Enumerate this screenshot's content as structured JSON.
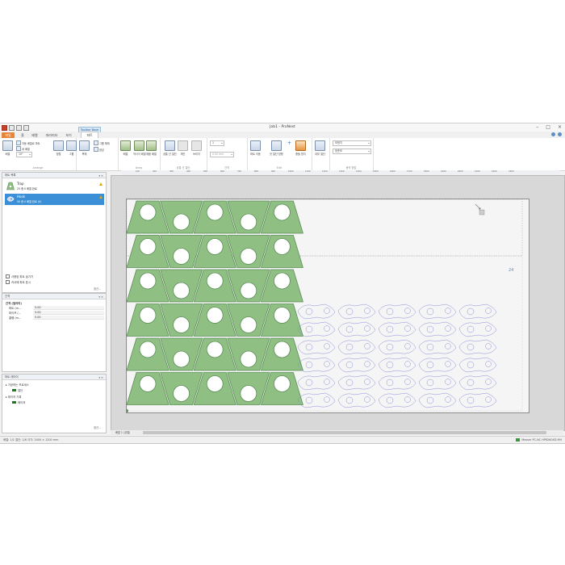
{
  "window": {
    "title": "Job1 - ProNest"
  },
  "tabs": {
    "file": "파일",
    "home": "홈",
    "nest": "배열",
    "cutting": "파라미터",
    "view": "보기",
    "context_group": "Toolbar Base",
    "context_tab": "파트"
  },
  "ribbon": {
    "nest_btn": "배열",
    "auto_nest": "자동 배열로 파트",
    "new_nest": "새 배열",
    "rotate_value": "10°",
    "align_btn": "정렬",
    "group_btn": "그룹",
    "copy_btn": "복제",
    "ungroup_btn": "그룹 해제",
    "lock_btn": "잠금",
    "arrange_label": "Arrange",
    "array_btn": "배열",
    "rect_array": "직사각 배열",
    "fill_array": "채움 배열",
    "array_label": "Array",
    "common_btn": "공통 선 절단",
    "chain_btn": "체인",
    "bridge_btn": "브리지",
    "common_label": "공통 선 절단",
    "spacing_value": "1",
    "spacing_mm": "0.00 mm",
    "spacing_label": "간격",
    "move_btn": "파트 이동",
    "cut_order": "컷 절단 방향",
    "plus": "+",
    "edit_label": "Edit",
    "collision": "충돌 방지",
    "inner": "내부 절단",
    "mirror_btn": "미러링",
    "view_sel1": "보정치",
    "view_sel2": "표준보",
    "view_label": "동작 방법"
  },
  "parts_panel": {
    "title": "파트 목록",
    "items": [
      {
        "name": "Trap",
        "sub": "25 중 0 배열 완료"
      },
      {
        "name": "Hook",
        "sub": "50 중 0 배열 완료 (0)"
      }
    ],
    "opt1": "사용된 파트 숨기기",
    "opt2": "커서에 파트 표시",
    "more": "옵션..."
  },
  "spacing_panel": {
    "title": "간격",
    "group": "간격 (밀리미)",
    "rows": [
      {
        "label": "파트 (m...",
        "value": "5.00"
      },
      {
        "label": "파이프 (...",
        "value": "5.00"
      },
      {
        "label": "클램 (m...",
        "value": "5.00"
      }
    ]
  },
  "layers_panel": {
    "title": "파트 레이어",
    "l1": "가공하는 프로세스",
    "l1a": "절단",
    "l2": "레이저 기록",
    "l2a": "레이저",
    "more": "옵션..."
  },
  "ruler": {
    "ticks": [
      "100",
      "200",
      "300",
      "400",
      "500",
      "600",
      "700",
      "800",
      "900",
      "1000",
      "1100",
      "1200",
      "1300",
      "1400",
      "1500",
      "1600",
      "1700",
      "1800",
      "1900",
      "2000",
      "2100",
      "2200",
      "2300"
    ]
  },
  "canvas": {
    "sheet_number": "24"
  },
  "sheet_tab": "배열 1 (강철)",
  "status": {
    "left": "배열: 1/1  절단: 1/6  크기: 2400 × 1200 mm",
    "right": "Messer PC-NC HPR260XD MH"
  },
  "colors": {
    "accent": "#e8833a",
    "part_fill": "#8fbf83",
    "part_stroke": "#5a8f55",
    "outline": "#8a8fd8",
    "select": "#3b8fd6"
  }
}
